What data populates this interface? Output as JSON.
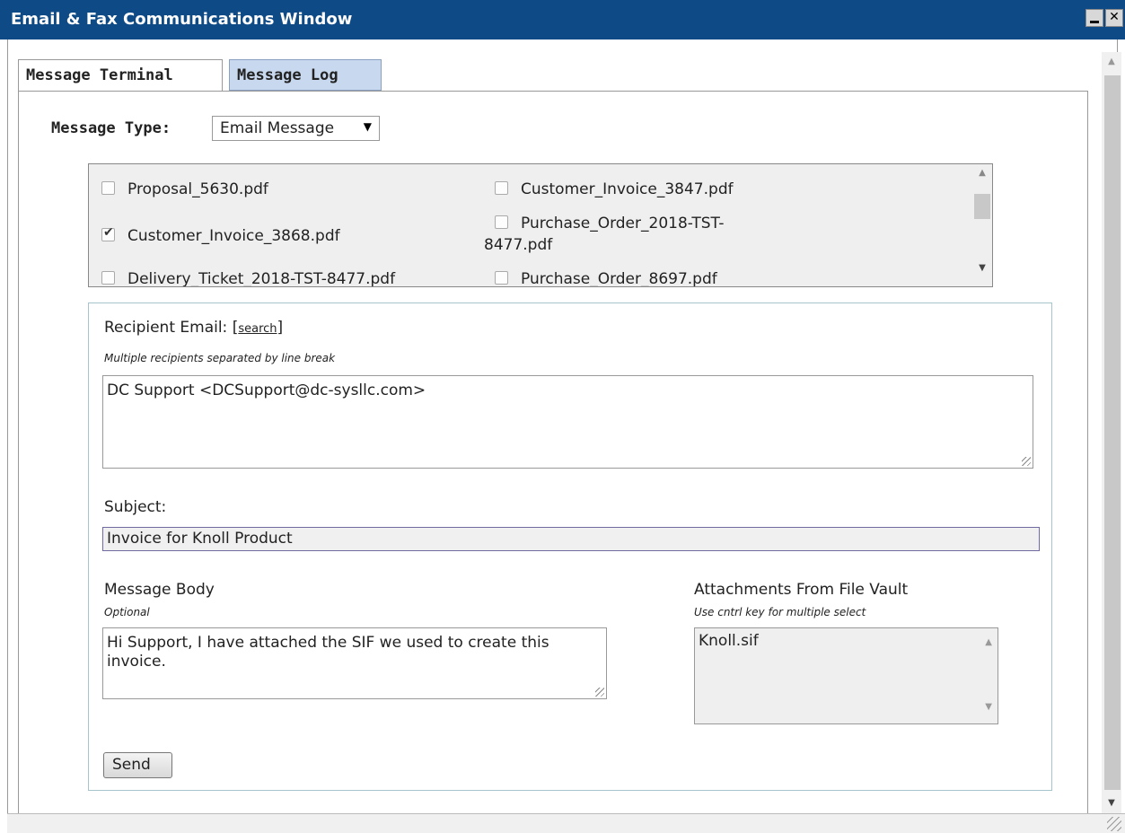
{
  "window": {
    "title": "Email & Fax Communications Window"
  },
  "tabs": [
    {
      "label": "Message Terminal",
      "active": true
    },
    {
      "label": "Message Log",
      "active": false
    }
  ],
  "message_type": {
    "label": "Message Type:",
    "value": "Email Message"
  },
  "files": [
    {
      "name": "Proposal_5630.pdf",
      "checked": false
    },
    {
      "name": "Customer_Invoice_3847.pdf",
      "checked": false
    },
    {
      "name": "Customer_Invoice_3868.pdf",
      "checked": true
    },
    {
      "name": "Purchase_Order_2018-TST-",
      "name_cont": "8477.pdf",
      "checked": false
    },
    {
      "name": "Delivery_Ticket_2018-TST-8477.pdf",
      "checked": false
    },
    {
      "name": "Purchase_Order_8697.pdf",
      "checked": false
    }
  ],
  "recipient": {
    "label": "Recipient Email: [",
    "search_link": "search",
    "label_end": "]",
    "hint": "Multiple recipients separated by line break",
    "value": "DC Support <DCSupport@dc-sysllc.com>"
  },
  "subject": {
    "label": "Subject:",
    "value": "Invoice for Knoll Product"
  },
  "body": {
    "label": "Message Body",
    "hint": "Optional",
    "value": "Hi Support, I have attached the SIF we used to create this invoice."
  },
  "attachments": {
    "label": "Attachments From File Vault",
    "hint": "Use cntrl key for multiple select",
    "options": [
      "Knoll.sif"
    ]
  },
  "send_label": "Send"
}
